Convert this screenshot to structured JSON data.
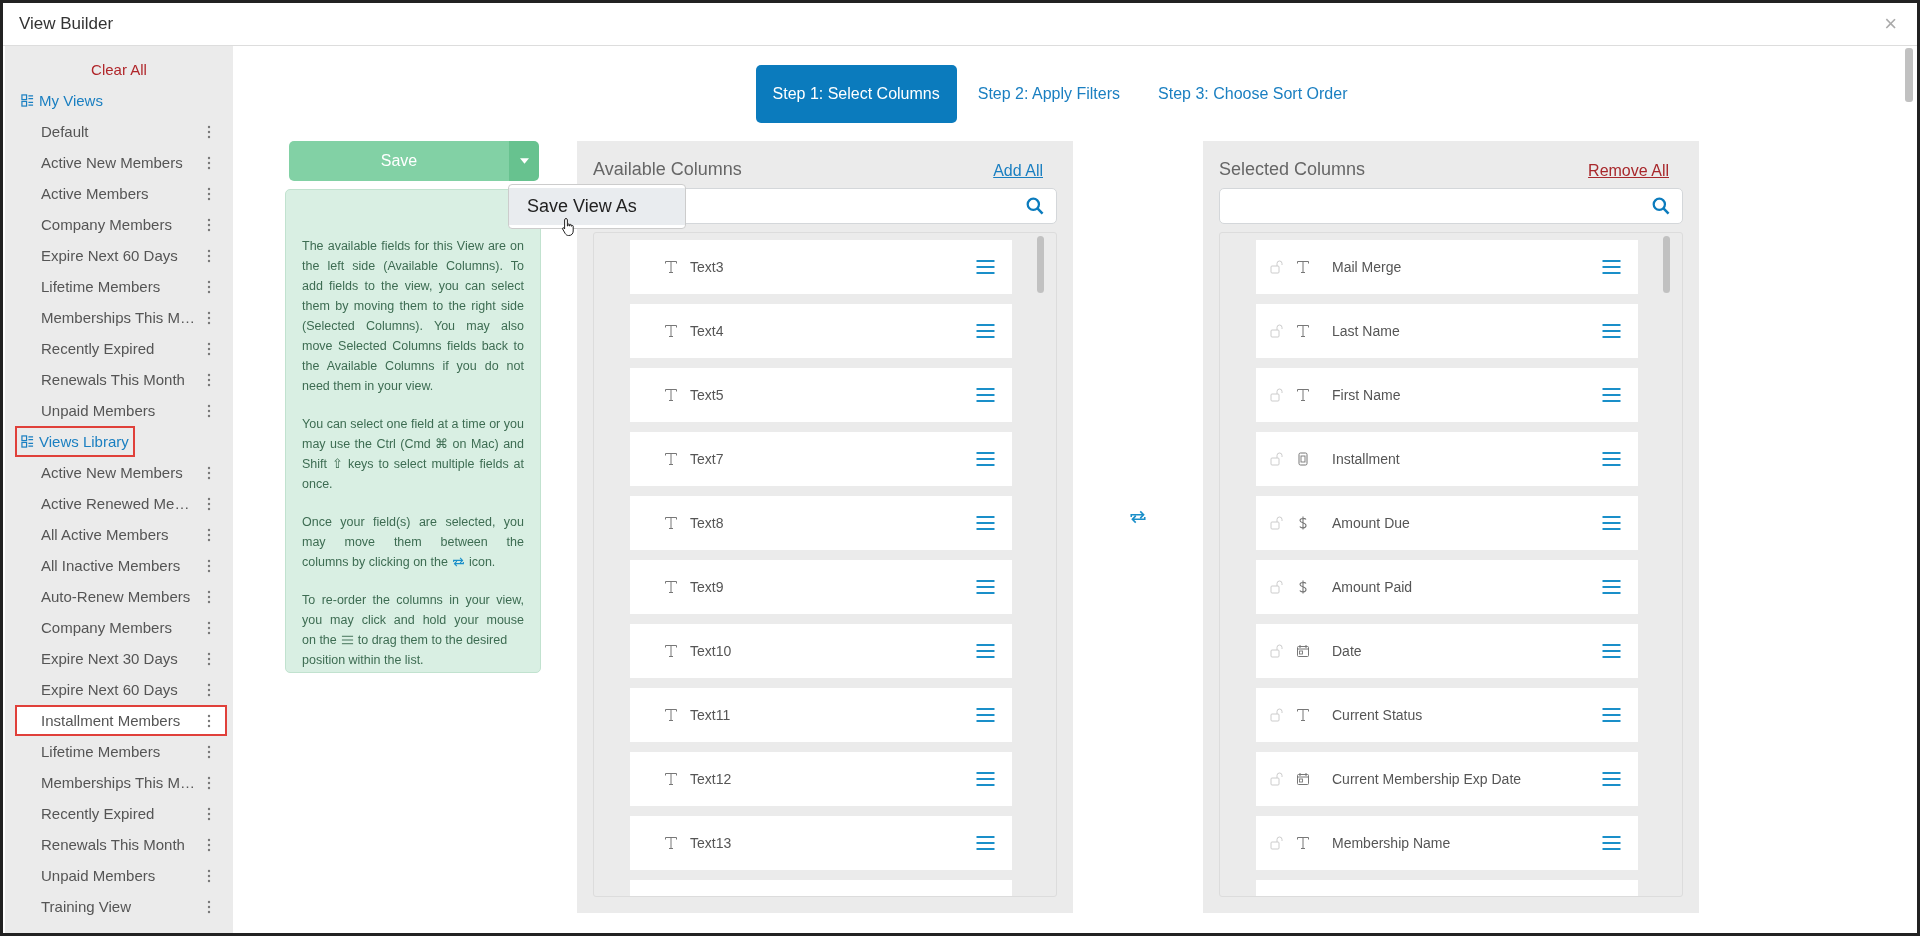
{
  "window": {
    "title": "View Builder",
    "close": "×"
  },
  "sidebar": {
    "clear_all": "Clear All",
    "groups": [
      {
        "label": "My Views",
        "highlighted": false,
        "items": [
          {
            "label": "Default",
            "highlighted": false
          },
          {
            "label": "Active New Members",
            "highlighted": false
          },
          {
            "label": "Active Members",
            "highlighted": false
          },
          {
            "label": "Company Members",
            "highlighted": false
          },
          {
            "label": "Expire Next 60 Days",
            "highlighted": false
          },
          {
            "label": "Lifetime Members",
            "highlighted": false
          },
          {
            "label": "Memberships This M…",
            "highlighted": false
          },
          {
            "label": "Recently Expired",
            "highlighted": false
          },
          {
            "label": "Renewals This Month",
            "highlighted": false
          },
          {
            "label": "Unpaid Members",
            "highlighted": false
          }
        ]
      },
      {
        "label": "Views Library",
        "highlighted": true,
        "items": [
          {
            "label": "Active New Members",
            "highlighted": false
          },
          {
            "label": "Active Renewed Me…",
            "highlighted": false
          },
          {
            "label": "All Active Members",
            "highlighted": false
          },
          {
            "label": "All Inactive Members",
            "highlighted": false
          },
          {
            "label": "Auto-Renew Members",
            "highlighted": false
          },
          {
            "label": "Company Members",
            "highlighted": false
          },
          {
            "label": "Expire Next 30 Days",
            "highlighted": false
          },
          {
            "label": "Expire Next 60 Days",
            "highlighted": false
          },
          {
            "label": "Installment Members",
            "highlighted": true
          },
          {
            "label": "Lifetime Members",
            "highlighted": false
          },
          {
            "label": "Memberships This M…",
            "highlighted": false
          },
          {
            "label": "Recently Expired",
            "highlighted": false
          },
          {
            "label": "Renewals This Month",
            "highlighted": false
          },
          {
            "label": "Unpaid Members",
            "highlighted": false
          },
          {
            "label": "Training View",
            "highlighted": false
          }
        ]
      }
    ]
  },
  "steps": [
    {
      "label": "Step 1: Select Columns",
      "selected": true
    },
    {
      "label": "Step 2: Apply Filters",
      "selected": false
    },
    {
      "label": "Step 3: Choose Sort Order",
      "selected": false
    }
  ],
  "save": {
    "label": "Save",
    "menu": [
      "Save View As"
    ]
  },
  "help": [
    {
      "text": "The available fields for this View are on the left side (Available Columns). To add fields to the view, you can select them by moving them to the right side (Selected Columns). You may also move Selected Columns fields back to the Available Columns if you do not need them in your view."
    },
    {
      "text": "You can select one field at a time or you may use the Ctrl (Cmd ⌘ on Mac) and Shift ⇧ keys to select multiple fields at once."
    },
    {
      "text": "Once your field(s) are selected, you may move them between the",
      "line": "columns by clicking on the",
      "after": "icon."
    },
    {
      "text": "To re-order the columns in your view, you may click and hold your mouse",
      "line": "on the",
      "after": "to drag them to the desired",
      "tail": "position within the list."
    }
  ],
  "available": {
    "title": "Available Columns",
    "action": "Add All",
    "fields": [
      {
        "label": "Text3",
        "kind": "text"
      },
      {
        "label": "Text4",
        "kind": "text"
      },
      {
        "label": "Text5",
        "kind": "text"
      },
      {
        "label": "Text7",
        "kind": "text"
      },
      {
        "label": "Text8",
        "kind": "text"
      },
      {
        "label": "Text9",
        "kind": "text"
      },
      {
        "label": "Text10",
        "kind": "text"
      },
      {
        "label": "Text11",
        "kind": "text"
      },
      {
        "label": "Text12",
        "kind": "text"
      },
      {
        "label": "Text13",
        "kind": "text"
      }
    ]
  },
  "selected": {
    "title": "Selected Columns",
    "action": "Remove All",
    "fields": [
      {
        "label": "Mail Merge",
        "kind": "text"
      },
      {
        "label": "Last Name",
        "kind": "text"
      },
      {
        "label": "First Name",
        "kind": "text"
      },
      {
        "label": "Installment",
        "kind": "installment"
      },
      {
        "label": "Amount Due",
        "kind": "currency"
      },
      {
        "label": "Amount Paid",
        "kind": "currency"
      },
      {
        "label": "Date",
        "kind": "date"
      },
      {
        "label": "Current Status",
        "kind": "text"
      },
      {
        "label": "Current Membership Exp Date",
        "kind": "date"
      },
      {
        "label": "Membership Name",
        "kind": "text"
      }
    ]
  }
}
